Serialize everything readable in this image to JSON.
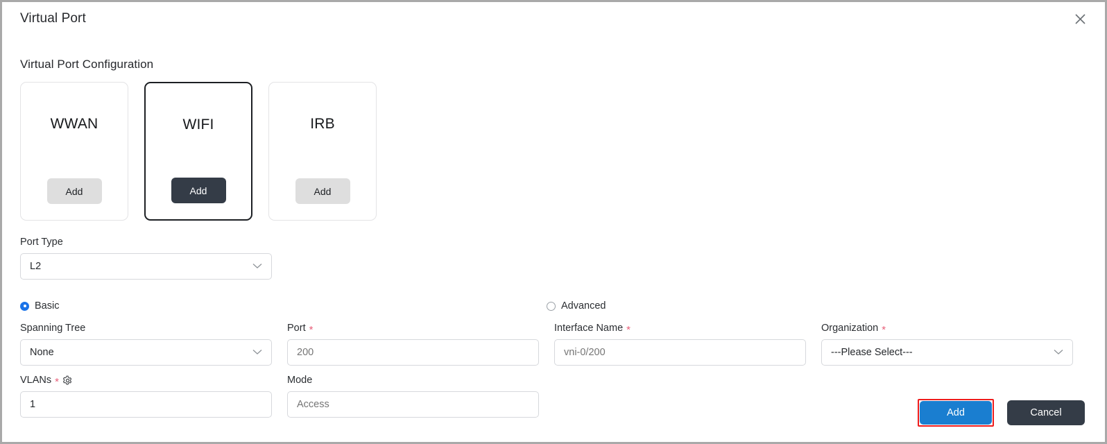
{
  "dialog": {
    "title": "Virtual Port",
    "close_icon": "close-icon"
  },
  "section": {
    "title": "Virtual Port Configuration"
  },
  "port_cards": [
    {
      "label": "WWAN",
      "button_label": "Add",
      "selected": false
    },
    {
      "label": "WIFI",
      "button_label": "Add",
      "selected": true
    },
    {
      "label": "IRB",
      "button_label": "Add",
      "selected": false
    }
  ],
  "port_type": {
    "label": "Port Type",
    "value": "L2",
    "icon": "chevron-down-icon"
  },
  "mode_radios": {
    "basic": {
      "label": "Basic",
      "selected": true
    },
    "advanced": {
      "label": "Advanced",
      "selected": false
    }
  },
  "fields": {
    "spanning_tree": {
      "label": "Spanning Tree",
      "value": "None",
      "required": false,
      "icon": "chevron-down-icon"
    },
    "port": {
      "label": "Port",
      "placeholder": "200",
      "required": true
    },
    "interface_name": {
      "label": "Interface Name",
      "placeholder": "vni-0/200",
      "required": true
    },
    "organization": {
      "label": "Organization",
      "value": "---Please Select---",
      "required": true,
      "icon": "chevron-down-icon"
    },
    "vlans": {
      "label": "VLANs",
      "value": "1",
      "required": true,
      "icon": "gear-icon"
    },
    "mode": {
      "label": "Mode",
      "placeholder": "Access",
      "required": false
    }
  },
  "footer": {
    "add_label": "Add",
    "cancel_label": "Cancel",
    "add_highlighted": true
  },
  "colors": {
    "primary_blue": "#1a7ed0",
    "dark_navy": "#343c47",
    "highlight_red": "#ee1c1c",
    "required_star": "#e8607a",
    "radio_blue": "#1a73e8"
  }
}
